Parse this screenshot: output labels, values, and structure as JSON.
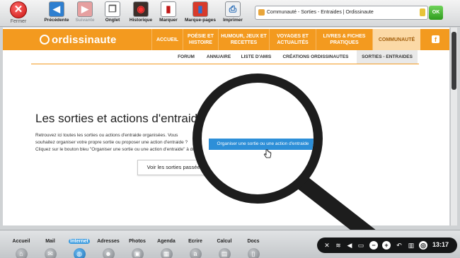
{
  "toolbar": {
    "close_label": "Fermer",
    "buttons": [
      {
        "label": "Précédente",
        "icon": "back-arrow-icon"
      },
      {
        "label": "Suivante",
        "icon": "forward-arrow-icon"
      },
      {
        "label": "Onglet",
        "icon": "tab-icon"
      },
      {
        "label": "Historique",
        "icon": "history-icon"
      },
      {
        "label": "Marquer",
        "icon": "bookmark-icon"
      },
      {
        "label": "Marque-pages",
        "icon": "bookmarks-icon"
      },
      {
        "label": "Imprimer",
        "icon": "printer-icon"
      }
    ],
    "url_text": "Communauté - Sorties - Entraides | Ordissinaute",
    "ok_label": "OK"
  },
  "site": {
    "logo": "ordissinaute",
    "nav": [
      {
        "label": "ACCUEIL"
      },
      {
        "label": "POÉSIE ET HISTOIRE"
      },
      {
        "label": "HUMOUR, JEUX ET RECETTES"
      },
      {
        "label": "VOYAGES ET ACTUALITÉS"
      },
      {
        "label": "LIVRES & FICHES PRATIQUES"
      },
      {
        "label": "COMMUNAUTÉ"
      }
    ],
    "fb_label": "f",
    "subnav": [
      {
        "label": "FORUM"
      },
      {
        "label": "ANNUAIRE"
      },
      {
        "label": "LISTE D'AMIS"
      },
      {
        "label": "CRÉATIONS ORDISSINAUTES"
      },
      {
        "label": "SORTIES - ENTRAIDES"
      }
    ]
  },
  "content": {
    "title": "Les sorties et actions d'entraide",
    "intro_line1": "Retrouvez ici toutes les sorties ou actions d'entraide organisées. Vous",
    "intro_line2": "souhaitez organiser votre propre sortie ou proposer une action d'entraide ?",
    "intro_line3": "Cliquez sur le bouton bleu \"Organiser une sortie ou une action d'entraide\" à droite.",
    "past_button": "Voir les sorties passées",
    "organize_button": "Organiser une sortie ou une action d'entraide"
  },
  "dock": {
    "items": [
      {
        "label": "Accueil",
        "icon": "home-icon"
      },
      {
        "label": "Mail",
        "icon": "mail-icon"
      },
      {
        "label": "Internet",
        "icon": "globe-icon"
      },
      {
        "label": "Adresses",
        "icon": "contacts-icon"
      },
      {
        "label": "Photos",
        "icon": "photos-icon"
      },
      {
        "label": "Agenda",
        "icon": "calendar-icon"
      },
      {
        "label": "Ecrire",
        "icon": "write-icon"
      },
      {
        "label": "Calcul",
        "icon": "calculator-icon"
      },
      {
        "label": "Docs",
        "icon": "docs-icon"
      }
    ],
    "active": "Internet",
    "clock": "13:17"
  },
  "colors": {
    "brand_orange": "#f39a1f",
    "action_blue": "#2d8fd8",
    "close_red": "#d42420"
  }
}
